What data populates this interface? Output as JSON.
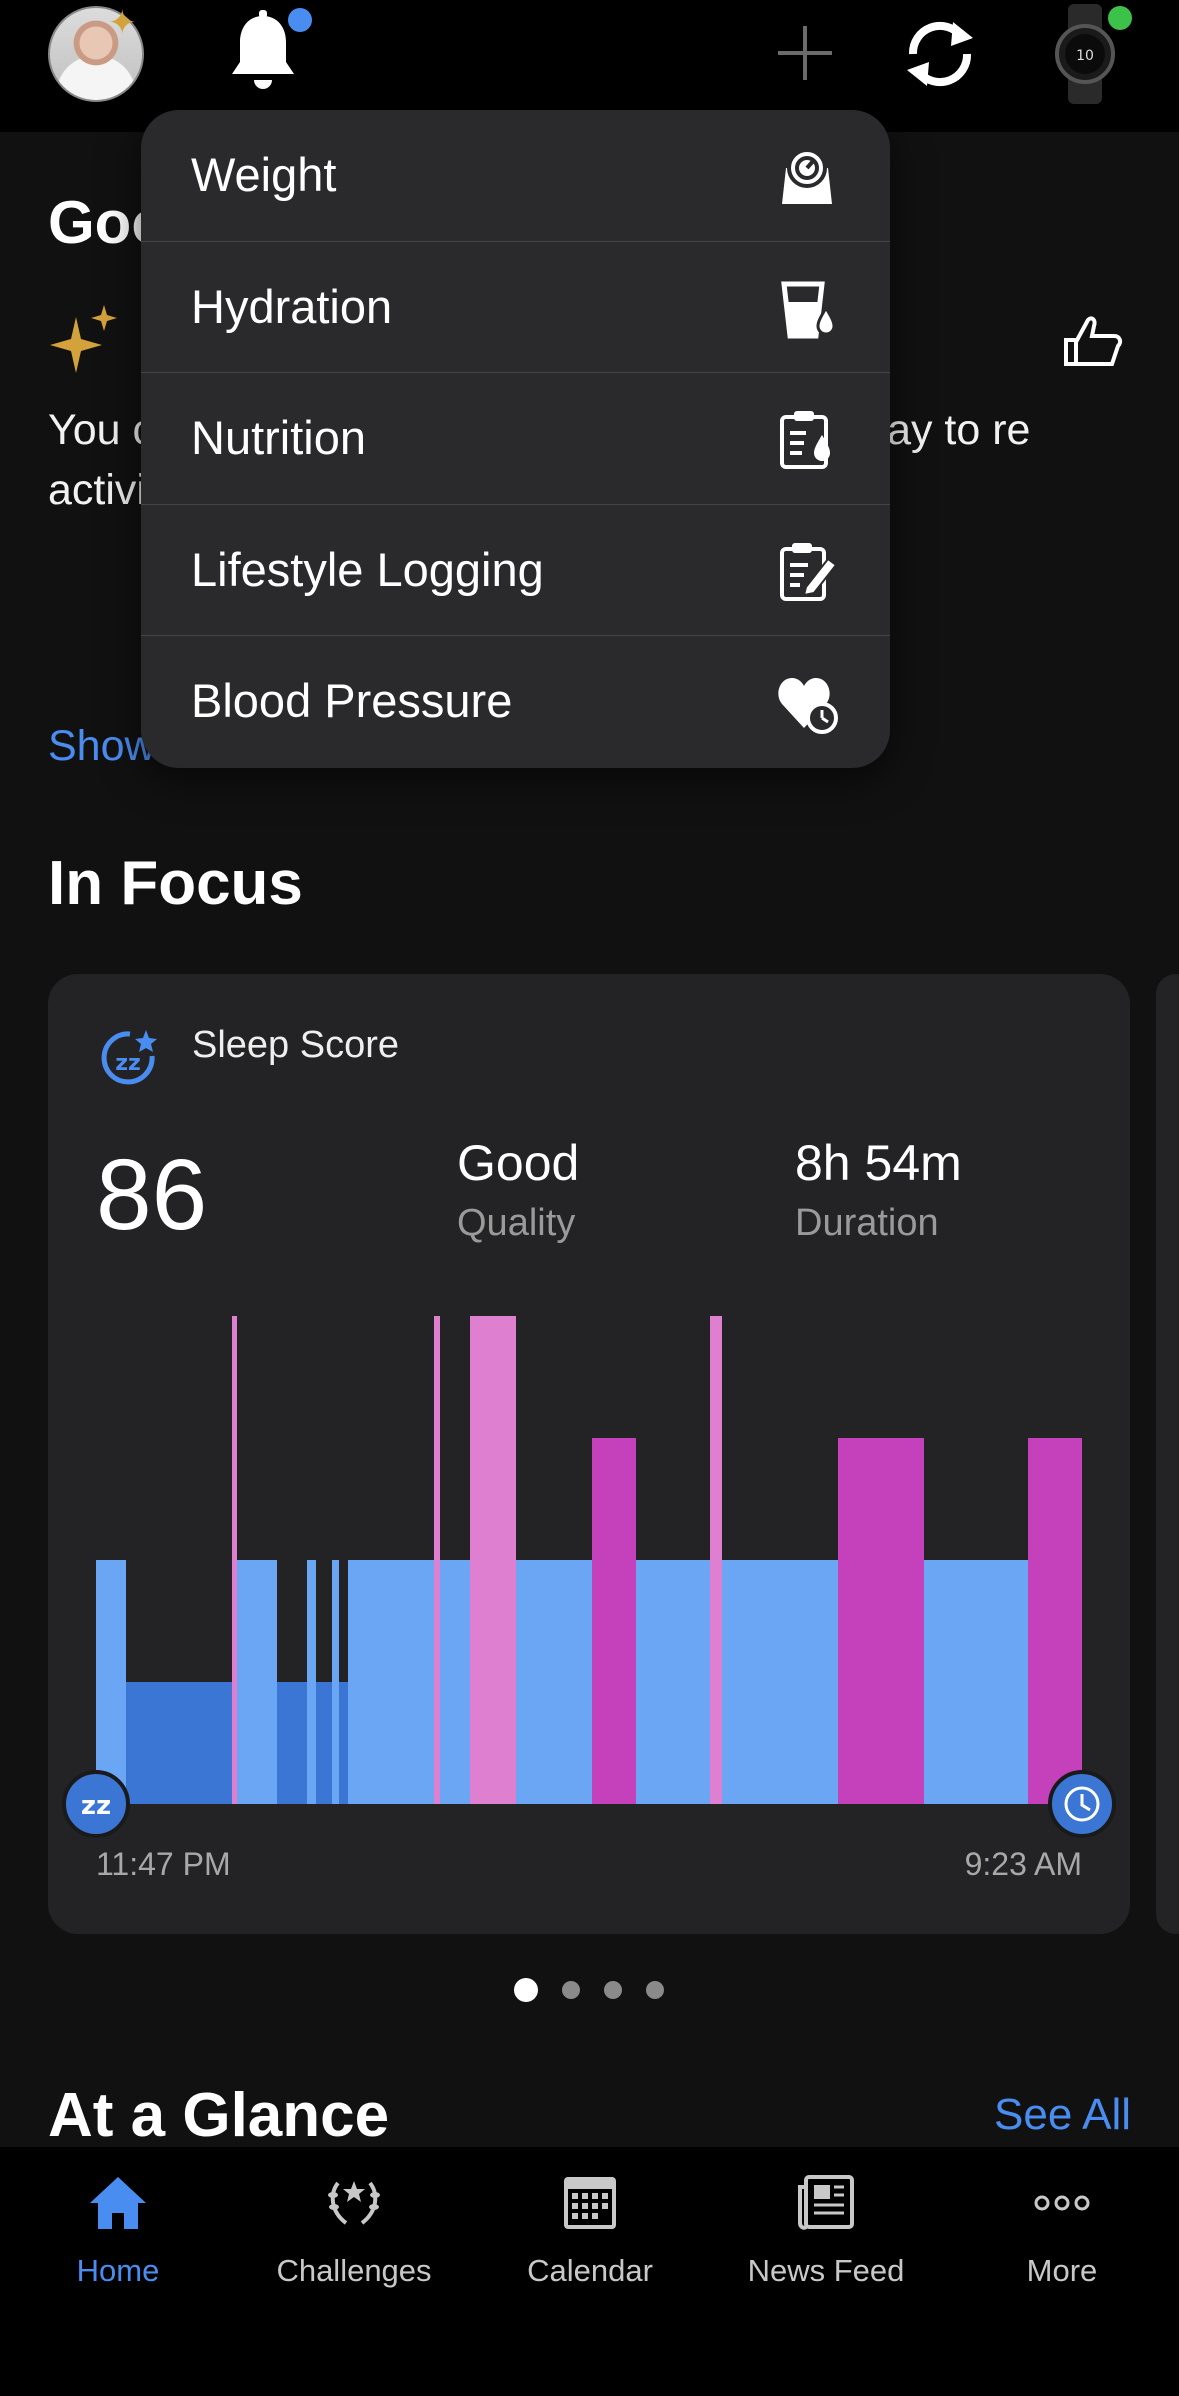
{
  "header": {
    "avatar_alt": "profile",
    "notification_dot_color": "#4a8df0",
    "watch_dot_color": "#3cc24a"
  },
  "greeting": "Goo",
  "insight": {
    "text": "You c                                    his week. To re                                   es, you need                                   have today to re                                   activity coun",
    "show_more": "Show"
  },
  "add_menu": {
    "items": [
      {
        "label": "Weight",
        "icon": "scale-icon"
      },
      {
        "label": "Hydration",
        "icon": "water-glass-icon"
      },
      {
        "label": "Nutrition",
        "icon": "nutrition-clipboard-icon"
      },
      {
        "label": "Lifestyle Logging",
        "icon": "edit-note-icon"
      },
      {
        "label": "Blood Pressure",
        "icon": "heart-clock-icon"
      }
    ]
  },
  "in_focus": {
    "title": "In Focus",
    "card": {
      "title": "Sleep Score",
      "score": "86",
      "quality_value": "Good",
      "quality_label": "Quality",
      "duration_value": "8h 54m",
      "duration_label": "Duration",
      "start_time": "11:47 PM",
      "end_time": "9:23 AM"
    },
    "pager": {
      "count": 4,
      "active": 0
    }
  },
  "at_a_glance": {
    "title": "At a Glance",
    "see_all": "See All"
  },
  "tabs": [
    {
      "label": "Home",
      "icon": "home-icon",
      "active": true
    },
    {
      "label": "Challenges",
      "icon": "laurel-icon",
      "active": false
    },
    {
      "label": "Calendar",
      "icon": "calendar-icon",
      "active": false
    },
    {
      "label": "News Feed",
      "icon": "news-icon",
      "active": false
    },
    {
      "label": "More",
      "icon": "more-icon",
      "active": false
    }
  ],
  "colors": {
    "accent": "#4a8df0",
    "deep_sleep": "#3b76d4",
    "light_sleep": "#6aa6f4",
    "rem_sleep": "#c540bb",
    "awake": "#de7fcf"
  }
}
